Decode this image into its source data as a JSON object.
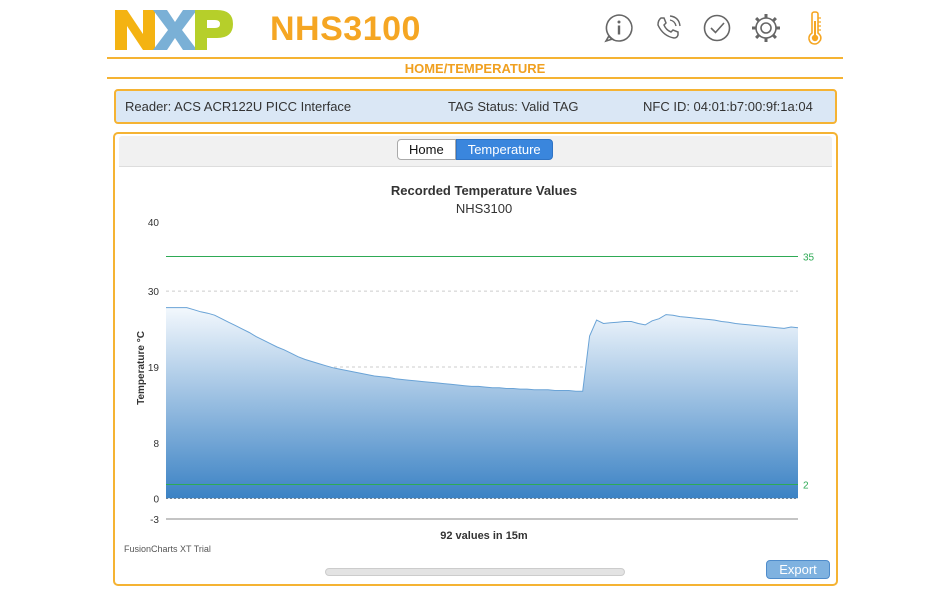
{
  "header": {
    "logo_text": "NXP",
    "title": "NHS3100",
    "icons": [
      "info-icon",
      "phone-icon",
      "clock-icon",
      "gear-icon",
      "thermometer-icon"
    ]
  },
  "breadcrumb": "HOME/TEMPERATURE",
  "infobar": {
    "reader": "Reader: ACS ACR122U PICC Interface",
    "tag_status": "TAG Status: Valid TAG",
    "nfc_id": "NFC ID: 04:01:b7:00:9f:1a:04"
  },
  "tabs": [
    {
      "label": "Home",
      "active": false
    },
    {
      "label": "Temperature",
      "active": true
    }
  ],
  "chart": {
    "watermark": "FusionCharts XT Trial",
    "export_label": "Export"
  },
  "chart_data": {
    "type": "area",
    "title": "Recorded Temperature Values",
    "subtitle": "NHS3100",
    "ylabel": "Temperature °C",
    "xlabel": "92 values in 15m",
    "ylim": [
      -3,
      40
    ],
    "y_ticks": [
      40,
      30,
      19,
      8,
      0,
      -3
    ],
    "n_values": 92,
    "trendlines": [
      {
        "label": "35",
        "value": 35,
        "color": "#2eaa55"
      },
      {
        "label": "2",
        "value": 2,
        "color": "#2eaa55"
      }
    ],
    "series": [
      {
        "values": [
          27.6,
          27.6,
          27.6,
          27.6,
          27.3,
          27.0,
          26.8,
          26.5,
          26.0,
          25.5,
          25.0,
          24.5,
          24.0,
          23.4,
          22.9,
          22.4,
          21.9,
          21.5,
          21.0,
          20.5,
          20.1,
          19.8,
          19.5,
          19.2,
          18.9,
          18.7,
          18.5,
          18.3,
          18.1,
          17.9,
          17.7,
          17.6,
          17.5,
          17.3,
          17.2,
          17.1,
          17.0,
          16.9,
          16.8,
          16.7,
          16.6,
          16.5,
          16.4,
          16.3,
          16.2,
          16.2,
          16.1,
          16.0,
          16.0,
          15.9,
          15.9,
          15.8,
          15.8,
          15.7,
          15.7,
          15.7,
          15.6,
          15.6,
          15.6,
          15.5,
          15.5,
          23.5,
          25.8,
          25.3,
          25.4,
          25.5,
          25.6,
          25.6,
          25.3,
          25.1,
          25.7,
          26.0,
          26.6,
          26.5,
          26.3,
          26.2,
          26.1,
          26.0,
          25.9,
          25.8,
          25.6,
          25.5,
          25.3,
          25.2,
          25.1,
          25.0,
          24.9,
          24.8,
          24.7,
          24.6,
          24.8,
          24.7
        ]
      }
    ]
  }
}
